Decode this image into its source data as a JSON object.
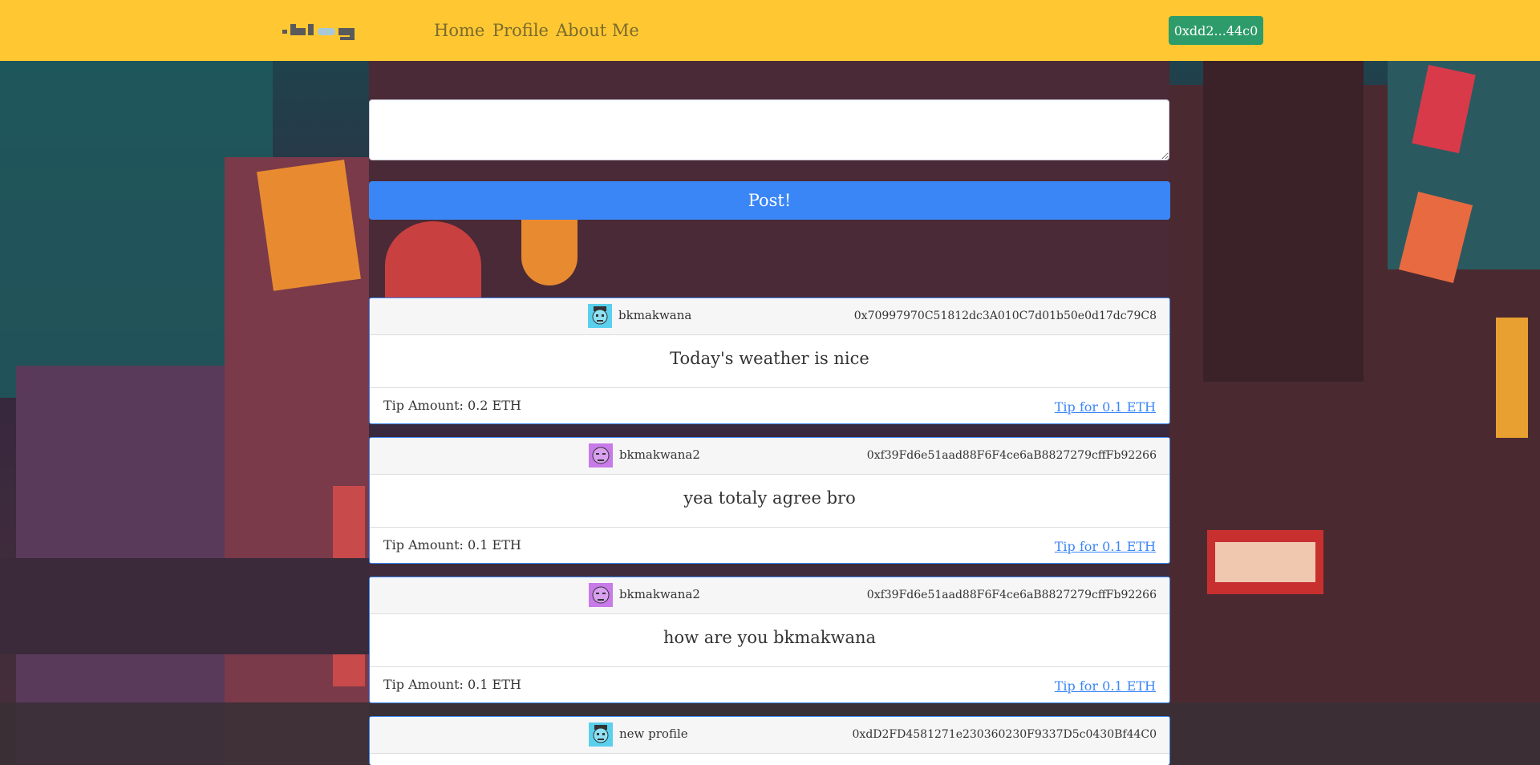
{
  "navbar": {
    "brand": "blog",
    "links": [
      "Home",
      "Profile",
      "About Me"
    ],
    "wallet": "0xdd2...44c0"
  },
  "composer": {
    "value": "",
    "post_label": "Post!"
  },
  "posts": [
    {
      "username": "bkmakwana",
      "address": "0x70997970C51812dc3A010C7d01b50e0d17dc79C8",
      "content": "Today's weather is nice",
      "tip_amount": "Tip Amount: 0.2 ETH",
      "tip_action": "Tip for 0.1 ETH",
      "avatar_icon": "face-blue-avatar-icon",
      "avatar_color": "#5ad0ee"
    },
    {
      "username": "bkmakwana2",
      "address": "0xf39Fd6e51aad88F6F4ce6aB8827279cffFb92266",
      "content": "yea totaly agree bro",
      "tip_amount": "Tip Amount: 0.1 ETH",
      "tip_action": "Tip for 0.1 ETH",
      "avatar_icon": "face-purple-avatar-icon",
      "avatar_color": "#c77ae8"
    },
    {
      "username": "bkmakwana2",
      "address": "0xf39Fd6e51aad88F6F4ce6aB8827279cffFb92266",
      "content": "how are you bkmakwana",
      "tip_amount": "Tip Amount: 0.1 ETH",
      "tip_action": "Tip for 0.1 ETH",
      "avatar_icon": "face-purple-avatar-icon",
      "avatar_color": "#c77ae8"
    },
    {
      "username": "new profile",
      "address": "0xdD2FD4581271e230360230F9337D5c0430Bf44C0",
      "content": "",
      "tip_amount": "",
      "tip_action": "",
      "avatar_icon": "face-blue-avatar-icon",
      "avatar_color": "#5ad0ee"
    }
  ],
  "colors": {
    "navbar": "#ffc832",
    "wallet_button": "#2e9c6a",
    "post_button": "#3a86f6",
    "card_border": "#3a86f6"
  }
}
